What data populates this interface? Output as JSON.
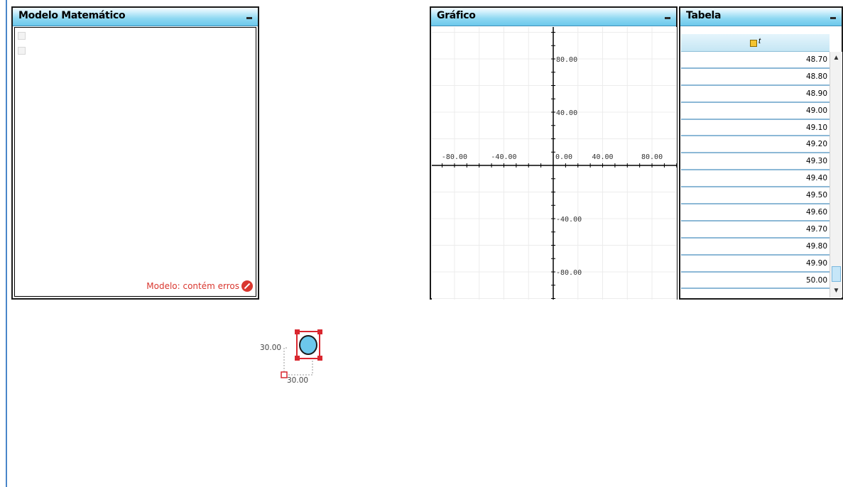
{
  "panels": {
    "modelo": {
      "title": "Modelo Matemático",
      "status_text": "Modelo: contém erros"
    },
    "grafico": {
      "title": "Gráfico"
    },
    "tabela": {
      "title": "Tabela",
      "column_var": "t"
    }
  },
  "graph": {
    "x_ticks": [
      "-80.00",
      "-40.00",
      "0.00",
      "40.00",
      "80.00"
    ],
    "y_ticks": [
      "80.00",
      "40.00",
      "-40.00",
      "-80.00"
    ]
  },
  "table_rows": [
    "48.70",
    "48.80",
    "48.90",
    "49.00",
    "49.10",
    "49.20",
    "49.30",
    "49.40",
    "49.50",
    "49.60",
    "49.70",
    "49.80",
    "49.90",
    "50.00"
  ],
  "canvas_object": {
    "width_label": "30.00",
    "height_label": "30.00"
  },
  "colors": {
    "accent": "#6cc8ec",
    "error": "#d9372f",
    "selection": "#d9272f"
  }
}
